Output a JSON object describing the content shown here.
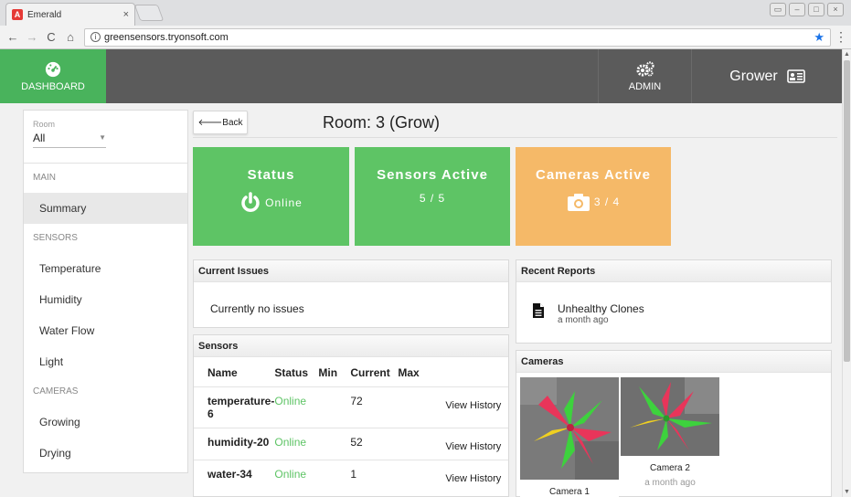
{
  "browser": {
    "tab_title": "Emerald",
    "tab_close": "×",
    "url": "greensensors.tryonsoft.com",
    "back": "←",
    "forward": "→",
    "reload": "C",
    "home": "⌂"
  },
  "header": {
    "dashboard_label": "DASHBOARD",
    "admin_label": "ADMIN",
    "user_label": "Grower"
  },
  "sidebar": {
    "room_label": "Room",
    "room_value": "All",
    "section_main": "MAIN",
    "section_sensors": "SENSORS",
    "section_cameras": "CAMERAS",
    "items": {
      "summary": "Summary",
      "temperature": "Temperature",
      "humidity": "Humidity",
      "water_flow": "Water Flow",
      "light": "Light",
      "growing": "Growing",
      "drying": "Drying"
    }
  },
  "main": {
    "back_label": "Back",
    "title": "Room: 3 (Grow)"
  },
  "tiles": {
    "status": {
      "title": "Status",
      "value": "Online"
    },
    "sensors": {
      "title": "Sensors Active",
      "value": "5 / 5"
    },
    "cameras": {
      "title": "Cameras Active",
      "value": "3 / 4"
    }
  },
  "colors": {
    "brand_green": "#49b35c",
    "tile_green": "#5ec465",
    "tile_orange": "#f5b968",
    "header_gray": "#5b5b5b"
  },
  "issues": {
    "title": "Current Issues",
    "text": "Currently no issues"
  },
  "reports": {
    "title": "Recent Reports",
    "items": [
      {
        "name": "Unhealthy Clones",
        "time": "a month ago"
      }
    ]
  },
  "sensors": {
    "title": "Sensors",
    "columns": [
      "Name",
      "Status",
      "Min",
      "Current",
      "Max"
    ],
    "action_label": "View History",
    "rows": [
      {
        "name": "temperature-6",
        "status": "Online",
        "min": "",
        "current": "72",
        "max": ""
      },
      {
        "name": "humidity-20",
        "status": "Online",
        "min": "",
        "current": "52",
        "max": ""
      },
      {
        "name": "water-34",
        "status": "Online",
        "min": "",
        "current": "1",
        "max": ""
      }
    ]
  },
  "cameras": {
    "title": "Cameras",
    "items": [
      {
        "name": "Camera 1",
        "time": ""
      },
      {
        "name": "Camera 2",
        "time": "a month ago"
      }
    ]
  }
}
